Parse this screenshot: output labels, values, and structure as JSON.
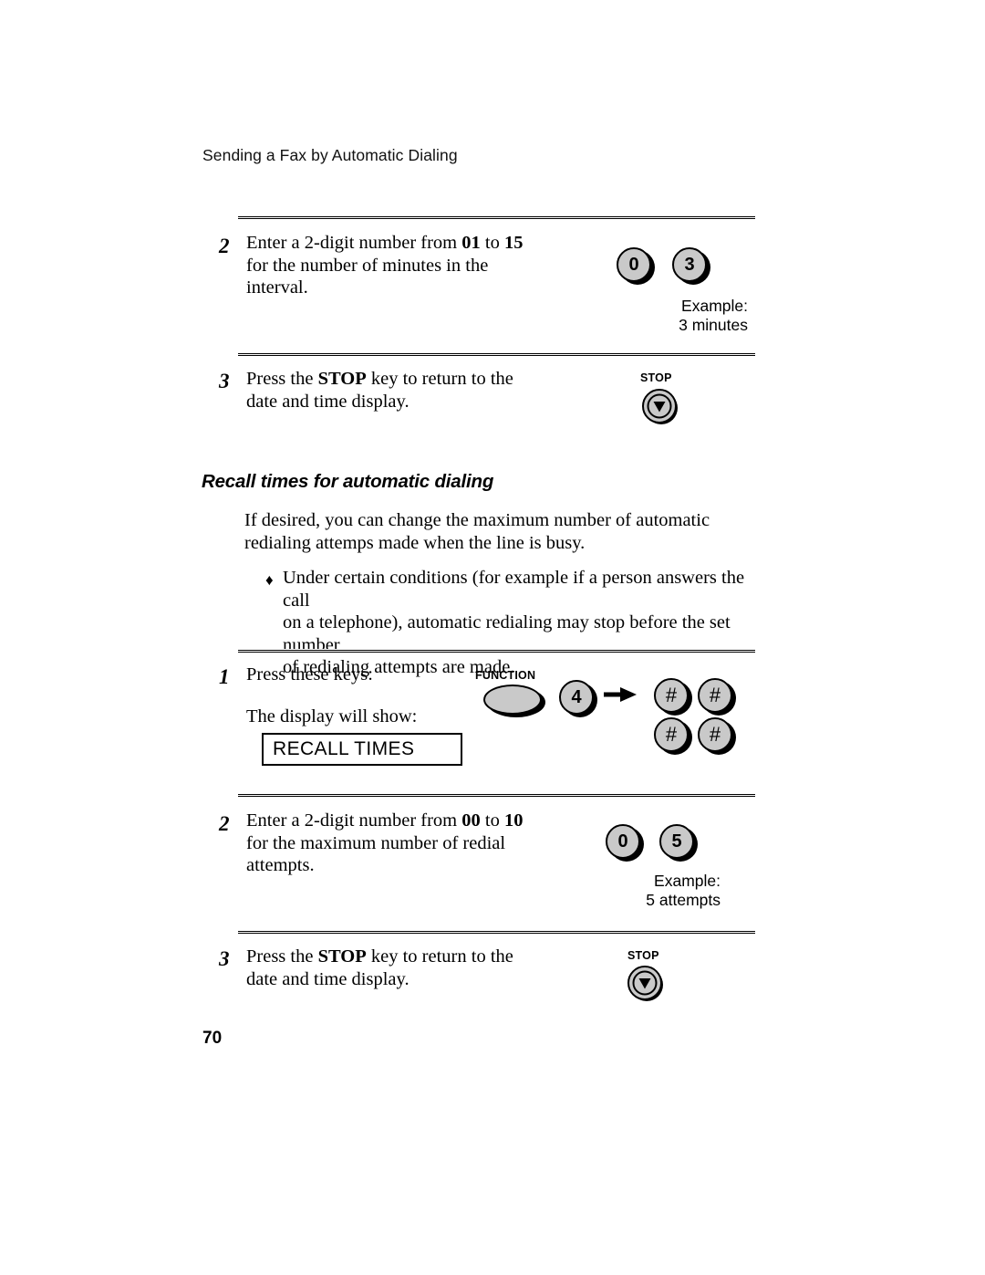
{
  "document": {
    "running_header": "Sending a Fax by Automatic Dialing",
    "page_number": "70"
  },
  "section_top": {
    "step2": {
      "number": "2",
      "line1_pre": "Enter a 2-digit number from ",
      "line1_b1": "01",
      "line1_mid": " to ",
      "line1_b2": "15",
      "line2": "for the number of minutes in the",
      "line3": "interval.",
      "keys": [
        "0",
        "3"
      ],
      "example_caption": "Example:\n3 minutes"
    },
    "step3": {
      "number": "3",
      "text_pre": "Press the ",
      "text_b": "STOP",
      "text_post": " key to return to the",
      "line2": "date and time display.",
      "key_label": "STOP"
    }
  },
  "section_recall": {
    "heading": "Recall times for automatic dialing",
    "intro_line1": "If desired, you can change the maximum number of automatic",
    "intro_line2": "redialing attemps made when the line is busy.",
    "bullet_glyph": "♦",
    "bullet_line1": "Under certain conditions (for example if a person answers the call",
    "bullet_line2": "on a telephone), automatic redialing may stop before the set number",
    "bullet_line3": "of redialing attempts are made.",
    "step1": {
      "number": "1",
      "prompt": "Press these keys:",
      "display_prompt": "The display will show:",
      "lcd_text": "RECALL TIMES",
      "function_label": "FUNCTION",
      "digit_key": "4",
      "hash_keys": [
        "#",
        "#",
        "#",
        "#"
      ]
    },
    "step2": {
      "number": "2",
      "line1_pre": "Enter a 2-digit number from ",
      "line1_b1": "00",
      "line1_mid": " to ",
      "line1_b2": "10",
      "line2": "for the maximum number of redial",
      "line3": "attempts.",
      "keys": [
        "0",
        "5"
      ],
      "example_caption": "Example:\n5 attempts"
    },
    "step3": {
      "number": "3",
      "text_pre": "Press the ",
      "text_b": "STOP",
      "text_post": " key to return to the",
      "line2": "date and time display.",
      "key_label": "STOP"
    }
  },
  "colors": {
    "key_fill": "#c9c9c9",
    "ink": "#000000",
    "paper": "#ffffff"
  }
}
